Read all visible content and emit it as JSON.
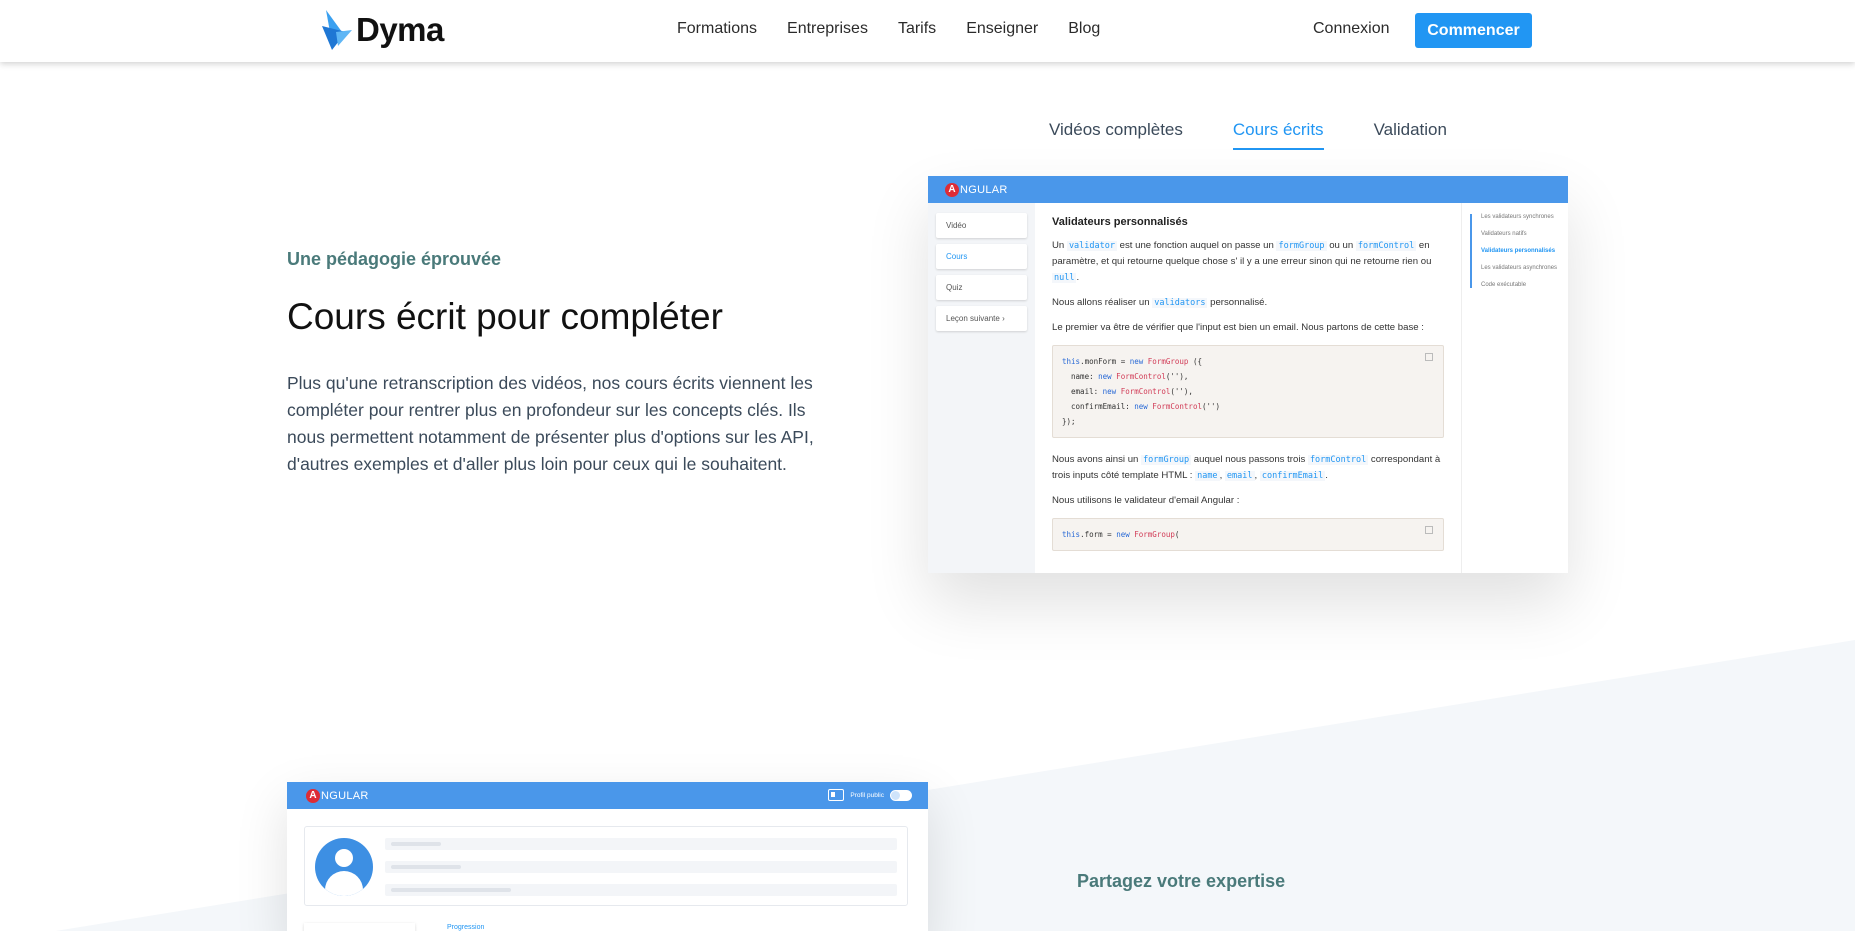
{
  "header": {
    "logo_text": "Dyma",
    "nav": [
      "Formations",
      "Entreprises",
      "Tarifs",
      "Enseigner",
      "Blog"
    ],
    "login": "Connexion",
    "cta": "Commencer"
  },
  "tabs": [
    "Vidéos complètes",
    "Cours écrits",
    "Validation"
  ],
  "active_tab": "Cours écrits",
  "section1": {
    "eyebrow": "Une pédagogie éprouvée",
    "title": "Cours écrit pour compléter",
    "text": "Plus qu'une retranscription des vidéos, nos cours écrits viennent les compléter pour rentrer plus en profondeur sur les concepts clés. Ils nous permettent notamment de présenter plus d'options sur les API, d'autres exemples et d'aller plus loin pour ceux qui le souhaitent."
  },
  "course_shot": {
    "brand_letter": "A",
    "brand_rest": "NGULAR",
    "side_items": [
      "Vidéo",
      "Cours",
      "Quiz",
      "Leçon suivante"
    ],
    "active_side": "Cours",
    "heading": "Validateurs personnalisés",
    "p1": {
      "a": "Un ",
      "code1": "validator",
      "b": " est une fonction auquel on passe un ",
      "code2": "formGroup",
      "c": " ou un ",
      "code3": "formControl",
      "d": " en paramètre, et qui retourne quelque chose s' il y a une erreur sinon qui ne retourne rien ou ",
      "code4": "null",
      "e": "."
    },
    "p2": {
      "a": "Nous allons réaliser un ",
      "code1": "validators",
      "b": " personnalisé."
    },
    "p3": "Le premier va être de vérifier que l'input est bien un email. Nous partons de cette base :",
    "code_block_1": {
      "l1_this": "this",
      "l1_rest": ".monForm = ",
      "l1_new": "new",
      "l1_cls": " FormGroup",
      "l1_end": " ({",
      "l2_key": "  name",
      "l2_sep": ": ",
      "l2_new": "new",
      "l2_cls": " FormControl",
      "l2_end": "(''),",
      "l3_key": "  email",
      "l3_sep": ": ",
      "l3_new": "new",
      "l3_cls": " FormControl",
      "l3_end": "(''),",
      "l4_key": "  confirmEmail",
      "l4_sep": ": ",
      "l4_new": "new",
      "l4_cls": " FormControl",
      "l4_end": "('')",
      "l5": "});"
    },
    "p4": {
      "a": "Nous avons ainsi un ",
      "code1": "formGroup",
      "b": " auquel nous passons trois ",
      "code2": "formControl",
      "c": " correspondant à trois inputs côté template HTML : ",
      "code3": "name",
      "d": ", ",
      "code4": "email",
      "e": ", ",
      "code5": "confirmEmail",
      "f": "."
    },
    "p5": "Nous utilisons le validateur d'email Angular :",
    "code_block_2": {
      "this": "this",
      "rest": ".form = ",
      "new": "new",
      "cls": " FormGroup",
      "end": "("
    },
    "toc": [
      "Les validateurs synchrones",
      "Validateurs natifs",
      "Validateurs personnalisés",
      "Les validateurs asynchrones",
      "Code exécutable"
    ],
    "toc_active": "Validateurs personnalisés"
  },
  "profile_shot": {
    "brand_letter": "A",
    "brand_rest": "NGULAR",
    "public_profile": "Profil public",
    "progress_label": "Progression"
  },
  "section2": {
    "eyebrow": "Partagez votre expertise"
  }
}
